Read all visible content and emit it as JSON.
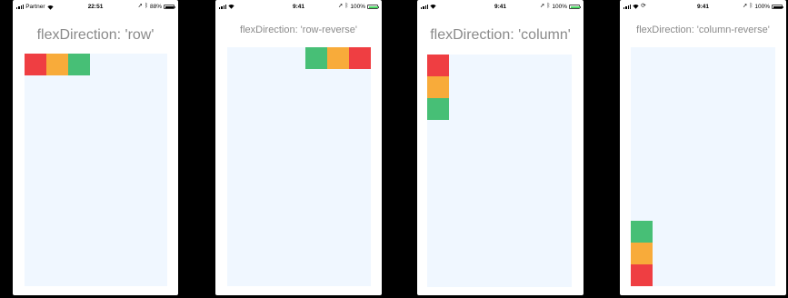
{
  "phones": [
    {
      "status": {
        "carrier": "Partner",
        "time": "22:51",
        "battery": "88%"
      },
      "title": "flexDirection: 'row'"
    },
    {
      "status": {
        "carrier": "",
        "time": "9:41",
        "battery": "100%"
      },
      "title": "flexDirection: 'row-reverse'"
    },
    {
      "status": {
        "carrier": "",
        "time": "9:41",
        "battery": "100%"
      },
      "title": "flexDirection: 'column'"
    },
    {
      "status": {
        "carrier": "",
        "time": "9:41",
        "battery": "100%"
      },
      "title": "flexDirection: 'column-reverse'"
    }
  ],
  "colors": {
    "red": "#ef3e42",
    "orange": "#f8ab3a",
    "green": "#47bf76",
    "container_bg": "#f0f7ff"
  },
  "icons": [
    "signal-icon",
    "wifi-icon",
    "location-arrow-icon",
    "bluetooth-icon",
    "battery-icon",
    "sync-icon"
  ]
}
